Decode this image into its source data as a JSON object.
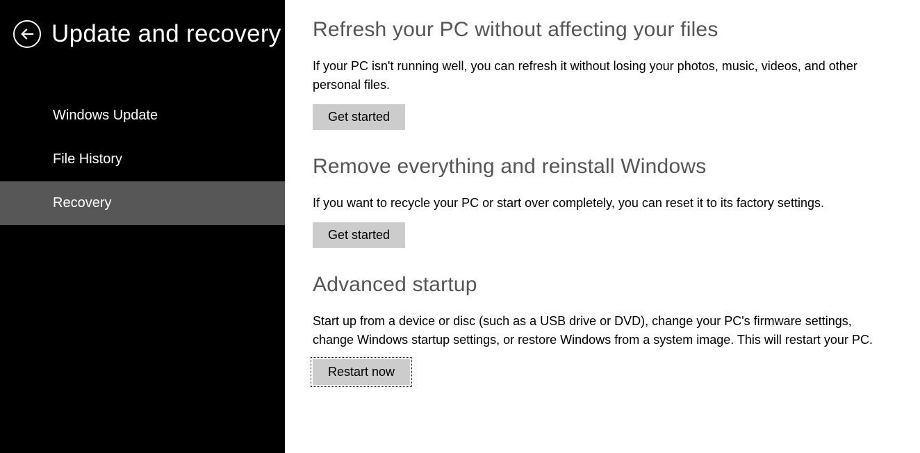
{
  "header": {
    "title": "Update and recovery"
  },
  "sidebar": {
    "items": [
      {
        "label": "Windows Update",
        "selected": false
      },
      {
        "label": "File History",
        "selected": false
      },
      {
        "label": "Recovery",
        "selected": true
      }
    ]
  },
  "sections": [
    {
      "title": "Refresh your PC without affecting your files",
      "description": "If your PC isn't running well, you can refresh it without losing your photos, music, videos, and other personal files.",
      "button_label": "Get started",
      "focused": false
    },
    {
      "title": "Remove everything and reinstall Windows",
      "description": "If you want to recycle your PC or start over completely, you can reset it to its factory settings.",
      "button_label": "Get started",
      "focused": false
    },
    {
      "title": "Advanced startup",
      "description": "Start up from a device or disc (such as a USB drive or DVD), change your PC's firmware settings, change Windows startup settings, or restore Windows from a system image. This will restart your PC.",
      "button_label": "Restart now",
      "focused": true
    }
  ]
}
